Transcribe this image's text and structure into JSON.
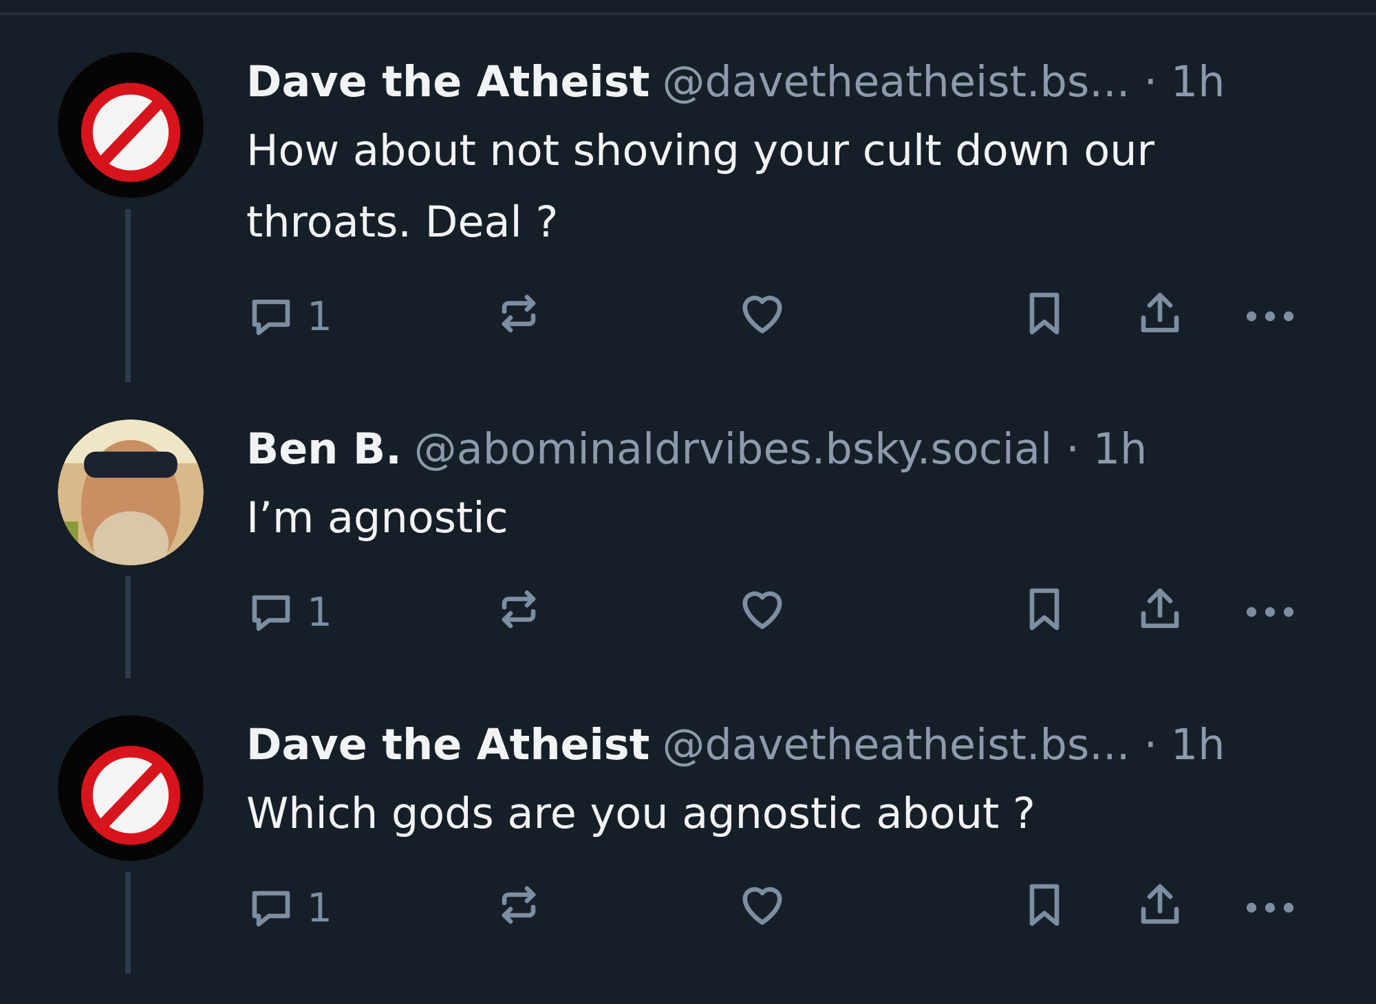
{
  "posts": [
    {
      "avatar": {
        "kind": "logo"
      },
      "name": "Dave the Atheist",
      "handle": "@davetheatheist.bs...",
      "time": "· 1h",
      "text": "How about not shoving your cult down our throats. Deal ?",
      "replies": "1",
      "thread_line": true
    },
    {
      "name": "Ben B.",
      "handle": "@abominaldrvibes.bsky.social",
      "time": "· 1h",
      "text": "I’m agnostic",
      "replies": "1",
      "thread_line": true
    },
    {
      "avatar": {
        "kind": "logo"
      },
      "name": "Dave the Atheist",
      "handle": "@davetheatheist.bs...",
      "time": "· 1h",
      "text": "Which gods are you agnostic about ?",
      "replies": "1",
      "thread_line": true
    }
  ]
}
